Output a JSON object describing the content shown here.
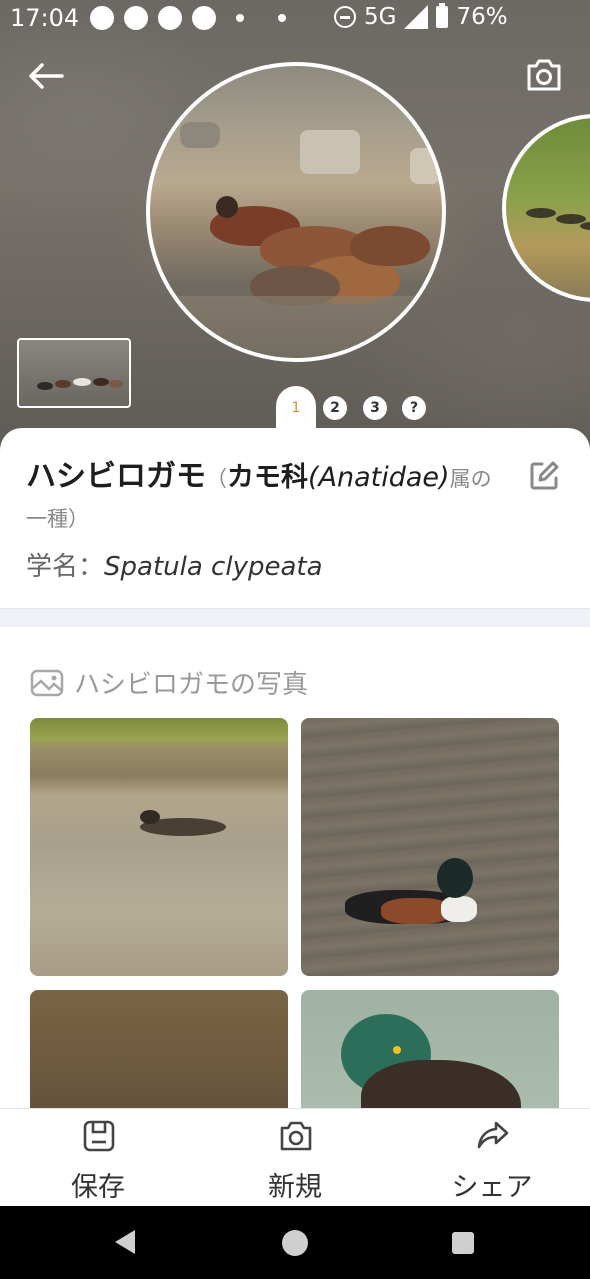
{
  "status_bar": {
    "time": "17:04",
    "network": "5G",
    "battery": "76%"
  },
  "hero": {
    "page_indicators": [
      "1",
      "2",
      "3",
      "?"
    ],
    "active_page": "1"
  },
  "species": {
    "name": "ハシビロガモ",
    "paren_open": "（",
    "family_name": "カモ科",
    "family_latin": "(Anatidae)",
    "suffix_1": "属の",
    "suffix_2": "一種）",
    "sci_label": "学名：",
    "sci_name": "Spatula clypeata"
  },
  "photos": {
    "header": "ハシビロガモの写真"
  },
  "bottom_bar": {
    "save_label": "保存",
    "new_label": "新規",
    "share_label": "シェア"
  },
  "colors": {
    "accent": "#e08a2a",
    "divider_bg": "#eef1f5"
  },
  "icons": [
    "back-arrow-icon",
    "camera-icon",
    "edit-icon",
    "image-icon",
    "save-icon",
    "share-icon"
  ]
}
